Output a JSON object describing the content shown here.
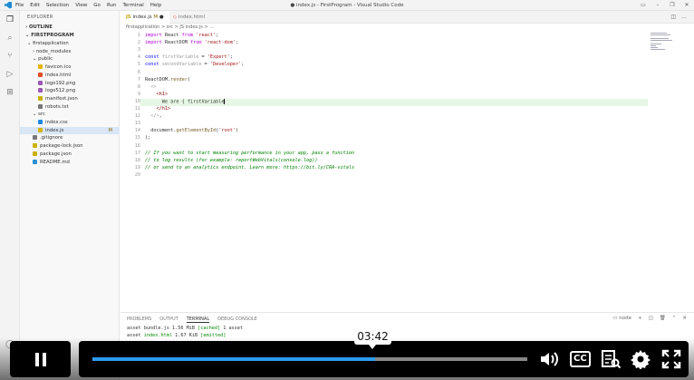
{
  "app": {
    "menu": [
      "File",
      "Edit",
      "Selection",
      "View",
      "Go",
      "Run",
      "Terminal",
      "Help"
    ],
    "title": "● index.js - FirstProgram - Visual Studio Code"
  },
  "sidebar": {
    "header": "EXPLORER",
    "outline": "OUTLINE",
    "project": "FIRSTPROGRAM",
    "items": [
      {
        "label": "firstapplication",
        "badge": ""
      },
      {
        "label": "node_modules",
        "badge": ""
      },
      {
        "label": "public",
        "badge": ""
      },
      {
        "label": "favicon.ico",
        "badge": ""
      },
      {
        "label": "index.html",
        "badge": ""
      },
      {
        "label": "logo192.png",
        "badge": ""
      },
      {
        "label": "logo512.png",
        "badge": ""
      },
      {
        "label": "manifest.json",
        "badge": ""
      },
      {
        "label": "robots.txt",
        "badge": ""
      },
      {
        "label": "src",
        "badge": ""
      },
      {
        "label": "index.css",
        "badge": ""
      },
      {
        "label": "index.js",
        "badge": "M"
      },
      {
        "label": ".gitignore",
        "badge": ""
      },
      {
        "label": "package-lock.json",
        "badge": ""
      },
      {
        "label": "package.json",
        "badge": ""
      },
      {
        "label": "README.md",
        "badge": ""
      }
    ]
  },
  "tabs": [
    {
      "label": "index.js",
      "badge": "M",
      "modified": "●"
    },
    {
      "label": "index.html",
      "badge": ""
    }
  ],
  "breadcrumb": "firstapplication > src > JS index.js > ...",
  "code": {
    "lines": [
      {
        "n": "1",
        "parts": [
          [
            "kw",
            "import"
          ],
          [
            "pl",
            " React "
          ],
          [
            "kw",
            "from"
          ],
          [
            "pl",
            " "
          ],
          [
            "str",
            "'react'"
          ],
          [
            "pl",
            ";"
          ]
        ]
      },
      {
        "n": "2",
        "parts": [
          [
            "kw",
            "import"
          ],
          [
            "pl",
            " ReactDOM "
          ],
          [
            "kw",
            "from"
          ],
          [
            "pl",
            " "
          ],
          [
            "str",
            "'react-dom'"
          ],
          [
            "pl",
            ";"
          ]
        ]
      },
      {
        "n": "3",
        "parts": []
      },
      {
        "n": "4",
        "parts": [
          [
            "bl",
            "const"
          ],
          [
            "pl",
            " "
          ],
          [
            "dim",
            "firstVariable"
          ],
          [
            "pl",
            " = "
          ],
          [
            "str",
            "'Expert'"
          ],
          [
            "pl",
            ";"
          ]
        ]
      },
      {
        "n": "5",
        "parts": [
          [
            "bl",
            "const"
          ],
          [
            "pl",
            " "
          ],
          [
            "dim",
            "secondVariable"
          ],
          [
            "pl",
            " = "
          ],
          [
            "str",
            "'Developer'"
          ],
          [
            "pl",
            ";"
          ]
        ]
      },
      {
        "n": "6",
        "parts": []
      },
      {
        "n": "7",
        "parts": [
          [
            "pl",
            "ReactDOM."
          ],
          [
            "fn",
            "render"
          ],
          [
            "pl",
            "("
          ]
        ]
      },
      {
        "n": "8",
        "parts": [
          [
            "pl",
            "  "
          ],
          [
            "dim",
            "<>"
          ]
        ]
      },
      {
        "n": "9",
        "parts": [
          [
            "pl",
            "    "
          ],
          [
            "tag",
            "<h1>"
          ]
        ]
      },
      {
        "n": "10",
        "parts": [
          [
            "pl",
            "      We are { firstVariable"
          ],
          [
            "cur",
            ""
          ]
        ]
      },
      {
        "n": "11",
        "parts": [
          [
            "pl",
            "    "
          ],
          [
            "tag",
            "</h1>"
          ]
        ]
      },
      {
        "n": "12",
        "parts": [
          [
            "pl",
            "  "
          ],
          [
            "dim",
            "</>"
          ],
          [
            "pl",
            ","
          ]
        ]
      },
      {
        "n": "13",
        "parts": []
      },
      {
        "n": "14",
        "parts": [
          [
            "pl",
            "  document."
          ],
          [
            "fn",
            "getElementById"
          ],
          [
            "pl",
            "("
          ],
          [
            "str",
            "'root'"
          ],
          [
            "pl",
            ")"
          ]
        ]
      },
      {
        "n": "15",
        "parts": [
          [
            "pl",
            ");"
          ]
        ]
      },
      {
        "n": "16",
        "parts": []
      },
      {
        "n": "17",
        "parts": [
          [
            "cm",
            "// If you want to start measuring performance in your app, pass a function"
          ]
        ]
      },
      {
        "n": "18",
        "parts": [
          [
            "cm",
            "// to log results (for example: reportWebVitals(console.log))"
          ]
        ]
      },
      {
        "n": "19",
        "parts": [
          [
            "cm",
            "// or send to an analytics endpoint. Learn more: https://bit.ly/CRA-vitals"
          ]
        ]
      },
      {
        "n": "20",
        "parts": []
      }
    ]
  },
  "panel": {
    "tabs": [
      "PROBLEMS",
      "OUTPUT",
      "TERMINAL",
      "DEBUG CONSOLE"
    ],
    "active_tab": "TERMINAL",
    "shell": "node",
    "terminal_lines": [
      [
        [
          "pl",
          "asset bundle.js 1.56 MiB "
        ],
        [
          "g",
          "[cached]"
        ],
        [
          "pl",
          " 1 asset"
        ]
      ],
      [
        [
          "pl",
          "asset "
        ],
        [
          "g",
          "index.html"
        ],
        [
          "pl",
          " 1.67 KiB "
        ],
        [
          "g",
          "[emitted]"
        ]
      ]
    ]
  },
  "video": {
    "time": "03:42",
    "progress": 0.65,
    "icons": [
      "pause-icon",
      "volume-icon",
      "captions-icon",
      "transcript-icon",
      "settings-icon",
      "fullscreen-icon"
    ],
    "cc_label": "CC",
    "accent": "#2e9bf0"
  }
}
